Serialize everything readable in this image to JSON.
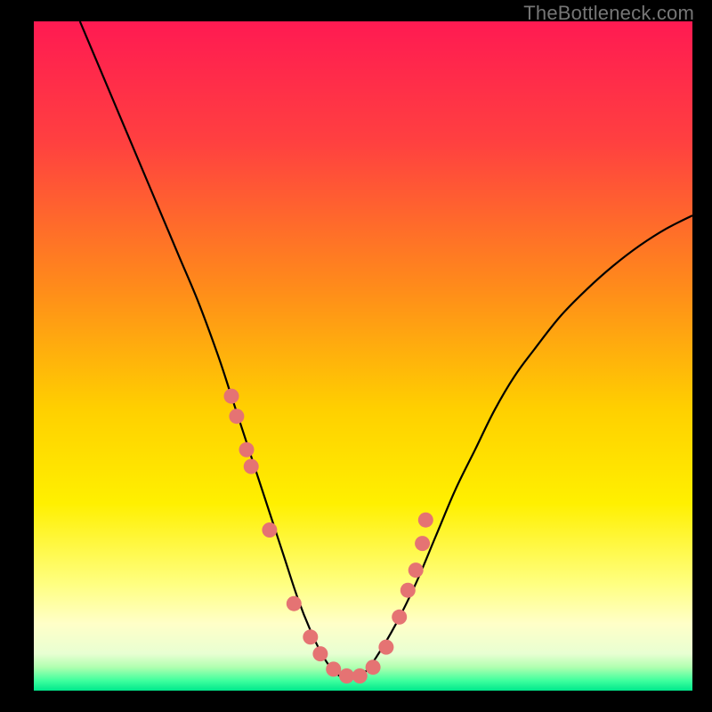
{
  "watermark": "TheBottleneck.com",
  "chart_data": {
    "type": "line",
    "title": "",
    "xlabel": "",
    "ylabel": "",
    "xlim": [
      0,
      100
    ],
    "ylim": [
      0,
      100
    ],
    "grid": false,
    "legend": false,
    "background_gradient": {
      "stops": [
        {
          "pos": 0.0,
          "color": "#ff1a52"
        },
        {
          "pos": 0.18,
          "color": "#ff4040"
        },
        {
          "pos": 0.4,
          "color": "#ff8c1a"
        },
        {
          "pos": 0.58,
          "color": "#ffd000"
        },
        {
          "pos": 0.72,
          "color": "#fff000"
        },
        {
          "pos": 0.84,
          "color": "#ffff80"
        },
        {
          "pos": 0.9,
          "color": "#ffffc8"
        },
        {
          "pos": 0.945,
          "color": "#e8ffd2"
        },
        {
          "pos": 0.965,
          "color": "#b0ffb0"
        },
        {
          "pos": 0.985,
          "color": "#3fff9e"
        },
        {
          "pos": 1.0,
          "color": "#00e88c"
        }
      ]
    },
    "series": [
      {
        "name": "bottleneck-curve",
        "stroke": "#000000",
        "x": [
          7,
          10,
          13,
          16,
          19,
          22,
          25,
          28,
          30,
          32,
          34,
          36,
          38,
          40,
          42,
          44,
          46,
          48,
          50,
          52,
          55,
          58,
          61,
          64,
          67,
          70,
          73,
          76,
          80,
          84,
          88,
          92,
          96,
          100
        ],
        "y": [
          100,
          93,
          86,
          79,
          72,
          65,
          58,
          50,
          44,
          38,
          32,
          26,
          20,
          14,
          9,
          5,
          2.5,
          1.8,
          2.5,
          5,
          10,
          16,
          23,
          30,
          36,
          42,
          47,
          51,
          56,
          60,
          63.5,
          66.5,
          69,
          71
        ]
      },
      {
        "name": "marker-dots",
        "type": "scatter",
        "color": "#e57373",
        "x": [
          30.0,
          30.8,
          32.3,
          33.0,
          35.8,
          39.5,
          42.0,
          43.5,
          45.5,
          47.5,
          49.5,
          51.5,
          53.5,
          55.5,
          56.8,
          58.0,
          59.0,
          59.5
        ],
        "y": [
          44.0,
          41.0,
          36.0,
          33.5,
          24.0,
          13.0,
          8.0,
          5.5,
          3.2,
          2.2,
          2.2,
          3.5,
          6.5,
          11.0,
          15.0,
          18.0,
          22.0,
          25.5
        ]
      }
    ]
  }
}
